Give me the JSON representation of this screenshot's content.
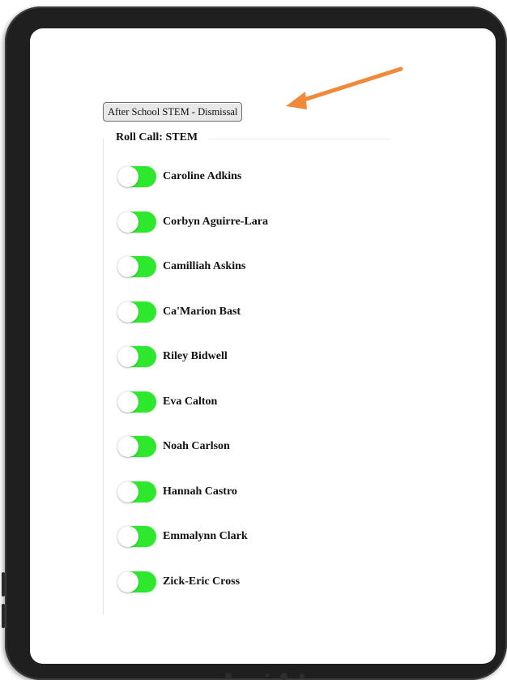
{
  "dismissal_button": {
    "label": "After School STEM - Dismissal"
  },
  "rollcall": {
    "title": "Roll Call: STEM",
    "students": [
      {
        "name": "Caroline Adkins",
        "present": true
      },
      {
        "name": "Corbyn Aguirre-Lara",
        "present": true
      },
      {
        "name": "Camilliah Askins",
        "present": true
      },
      {
        "name": "Ca'Marion Bast",
        "present": true
      },
      {
        "name": "Riley Bidwell",
        "present": true
      },
      {
        "name": "Eva Calton",
        "present": true
      },
      {
        "name": "Noah Carlson",
        "present": true
      },
      {
        "name": "Hannah Castro",
        "present": true
      },
      {
        "name": "Emmalynn Clark",
        "present": true
      },
      {
        "name": "Zick-Eric Cross",
        "present": true
      }
    ]
  },
  "colors": {
    "toggle_on": "#2de82d",
    "arrow": "#f0893a",
    "device_frame": "#1f1f1f"
  },
  "icons": {
    "annotation": "orange-arrow-icon"
  }
}
